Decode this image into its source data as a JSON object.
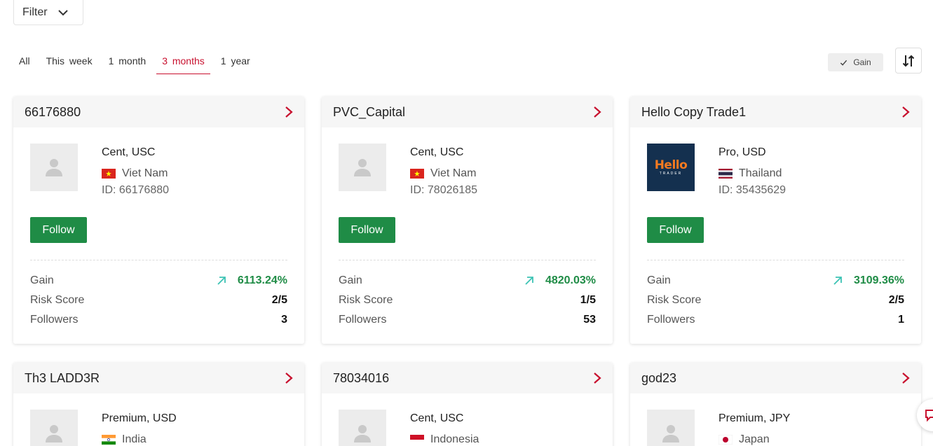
{
  "filter": {
    "label": "Filter"
  },
  "tabs": [
    {
      "label": "All",
      "active": false
    },
    {
      "label": "This week",
      "active": false
    },
    {
      "label": "1 month",
      "active": false
    },
    {
      "label": "3 months",
      "active": true
    },
    {
      "label": "1 year",
      "active": false
    }
  ],
  "sort_chip": {
    "label": "Gain"
  },
  "stat_labels": {
    "gain": "Gain",
    "risk": "Risk Score",
    "followers": "Followers"
  },
  "follow_label": "Follow",
  "colors": {
    "accent": "#c8102e",
    "follow": "#1f8c46",
    "gain_text": "#1f8c46",
    "gain_icon": "#3cc3b4"
  },
  "cards": [
    {
      "name": "66176880",
      "account": "Cent, USC",
      "country": "Viet Nam",
      "flag": "vietnam-flag",
      "id": "ID: 66176880",
      "avatar": "placeholder",
      "gain": "6113.24%",
      "risk": "2/5",
      "followers": "3"
    },
    {
      "name": "PVC_Capital",
      "account": "Cent, USC",
      "country": "Viet Nam",
      "flag": "vietnam-flag",
      "id": "ID: 78026185",
      "avatar": "placeholder",
      "gain": "4820.03%",
      "risk": "1/5",
      "followers": "53"
    },
    {
      "name": "Hello Copy Trade1",
      "account": "Pro, USD",
      "country": "Thailand",
      "flag": "thailand-flag",
      "id": "ID: 35435629",
      "avatar": "hello-trader-logo",
      "logo_text": "Hello",
      "logo_sub": "TRADER",
      "gain": "3109.36%",
      "risk": "2/5",
      "followers": "1"
    },
    {
      "name": "Th3 LADD3R",
      "account": "Premium, USD",
      "country": "India",
      "flag": "india-flag",
      "avatar": "placeholder"
    },
    {
      "name": "78034016",
      "account": "Cent, USC",
      "country": "Indonesia",
      "flag": "indonesia-flag",
      "avatar": "placeholder"
    },
    {
      "name": "god23",
      "account": "Premium, JPY",
      "country": "Japan",
      "flag": "japan-flag",
      "avatar": "placeholder"
    }
  ]
}
